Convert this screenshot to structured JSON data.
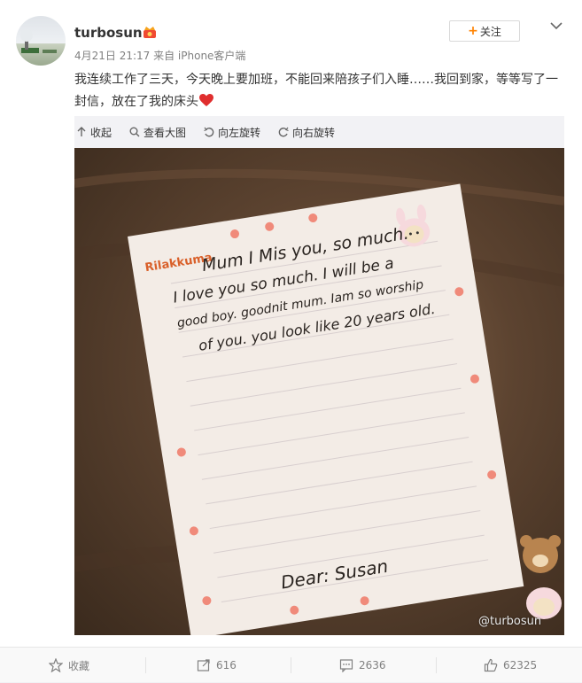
{
  "post": {
    "username": "turbosun",
    "meta": "4月21日 21:17 来自 iPhone客户端",
    "follow_label": "关注",
    "follow_plus": "+",
    "text": "我连续工作了三天，今天晚上要加班，不能回来陪孩子们入睡……我回到家，等等写了一封信，放在了我的床头"
  },
  "image_toolbar": {
    "collapse": "收起",
    "view_large": "查看大图",
    "rotate_left": "向左旋转",
    "rotate_right": "向右旋转"
  },
  "photo": {
    "brand": "Rilakkuma",
    "line1": "Mum   I Mis you, so much.",
    "line2": "I love you so much. I will be a",
    "line3": "good boy. goodnit mum. Iam so worship",
    "line4": "of you. you look like 20 years old.",
    "signature": "Dear: Susan",
    "watermark": "@turbosun"
  },
  "actions": {
    "favorite": "收藏",
    "repost": "616",
    "comment": "2636",
    "like": "62325"
  },
  "colors": {
    "accent": "#ff8200",
    "heart": "#e02e2e",
    "toolbar_bg": "#f2f2f5"
  }
}
